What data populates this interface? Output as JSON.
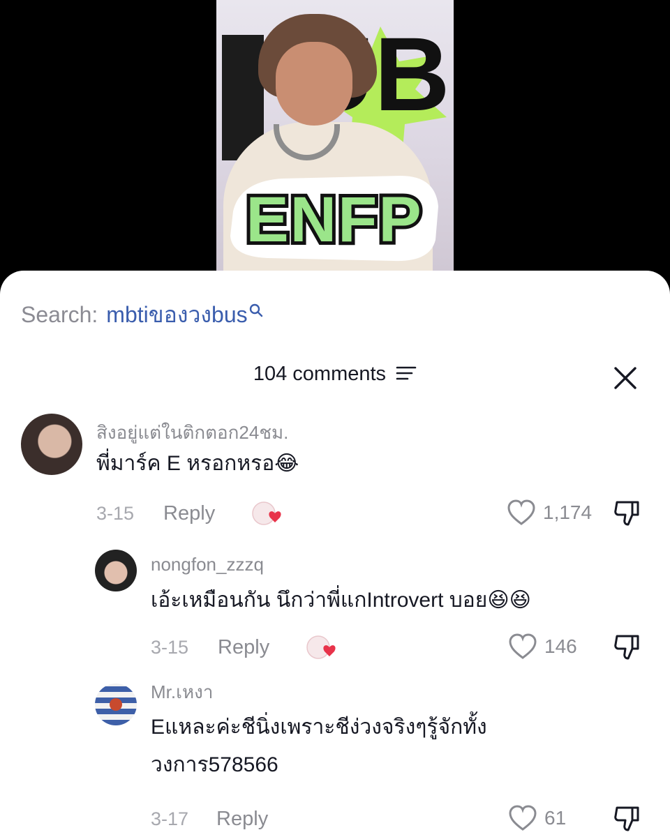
{
  "video": {
    "overlay_text": "ENFP",
    "bg_logo_text": "UB"
  },
  "search": {
    "label": "Search:",
    "term": "mbtiของวงbus"
  },
  "header": {
    "comments_count": "104 comments"
  },
  "comments": [
    {
      "username": "สิงอยู่แต่ในติกตอก24ชม.",
      "text": "พี่มาร์ค E หรอกหรอ",
      "emoji": "😂",
      "date": "3-15",
      "reply_label": "Reply",
      "likes": "1,174"
    },
    {
      "username": "nongfon_zzzq",
      "text": "เอ้ะเหมือนกัน นึกว่าพี่แกIntrovert บอย",
      "emoji": "😆😆",
      "date": "3-15",
      "reply_label": "Reply",
      "likes": "146"
    },
    {
      "username": "Mr.เหงา",
      "text_line1": "Eแหละค่ะชีนิ่งเพราะชีง่วงจริงๆรู้จักทั้ง",
      "text_line2": "วงการ578566",
      "date": "3-17",
      "reply_label": "Reply",
      "likes": "61"
    }
  ],
  "colors": {
    "search_term": "#3a5dad",
    "muted_text": "#8a8b91",
    "enfp_fill": "#9be58a",
    "heart_accent": "#e8334a"
  }
}
